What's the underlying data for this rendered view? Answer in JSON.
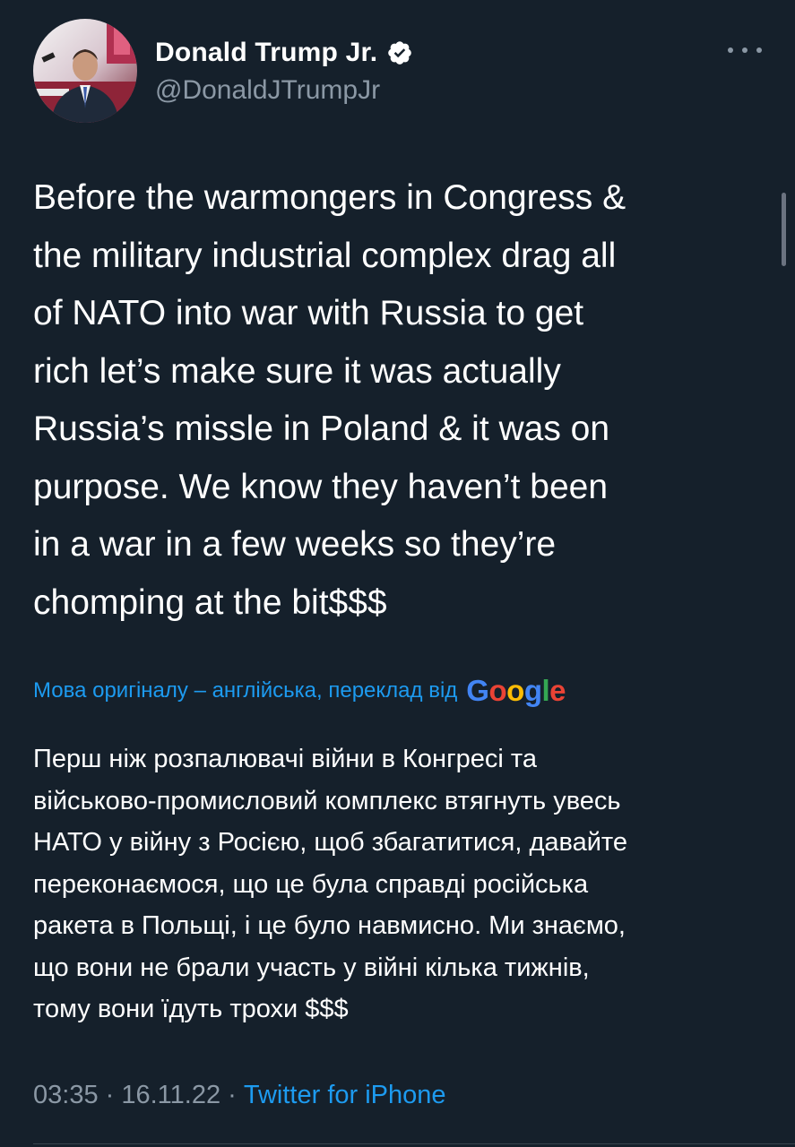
{
  "author": {
    "display_name": "Donald Trump Jr.",
    "handle": "@DonaldJTrumpJr",
    "avatar_icon": "avatar-photo",
    "verified_icon": "verified-badge-icon"
  },
  "tweet": {
    "text": "Before the warmongers in Congress &\nthe military industrial complex drag all\nof NATO into war with Russia to get\nrich let’s make sure it was actually\nRussia’s missle in Poland & it was on\npurpose. We know they haven’t been\nin a war in a few weeks so they’re\nchomping at the bit$$$"
  },
  "translation": {
    "label": "Мова оригіналу – англійська, переклад від",
    "provider": "Google",
    "text": "Перш ніж розпалювачі війни в Конгресі та\nвійськово-промисловий комплекс втягнуть увесь\nНАТО у війну з Росією, щоб збагатитися, давайте\nпереконаємося, що це була справді російська\nракета в Польщі, і це було навмисно. Ми знаємо,\nщо вони не брали участь у війні кілька тижнів,\nтому вони їдуть трохи $$$"
  },
  "meta": {
    "time": "03:35",
    "separator1": " · ",
    "date": "16.11.22",
    "separator2": " · ",
    "source": "Twitter for iPhone"
  },
  "colors": {
    "background": "#15202b",
    "text": "#ffffff",
    "secondary": "#8b98a5",
    "accent": "#1d9bf0",
    "google_blue": "#4285f4",
    "google_red": "#ea4335",
    "google_yellow": "#fbbc05",
    "google_green": "#34a853"
  }
}
